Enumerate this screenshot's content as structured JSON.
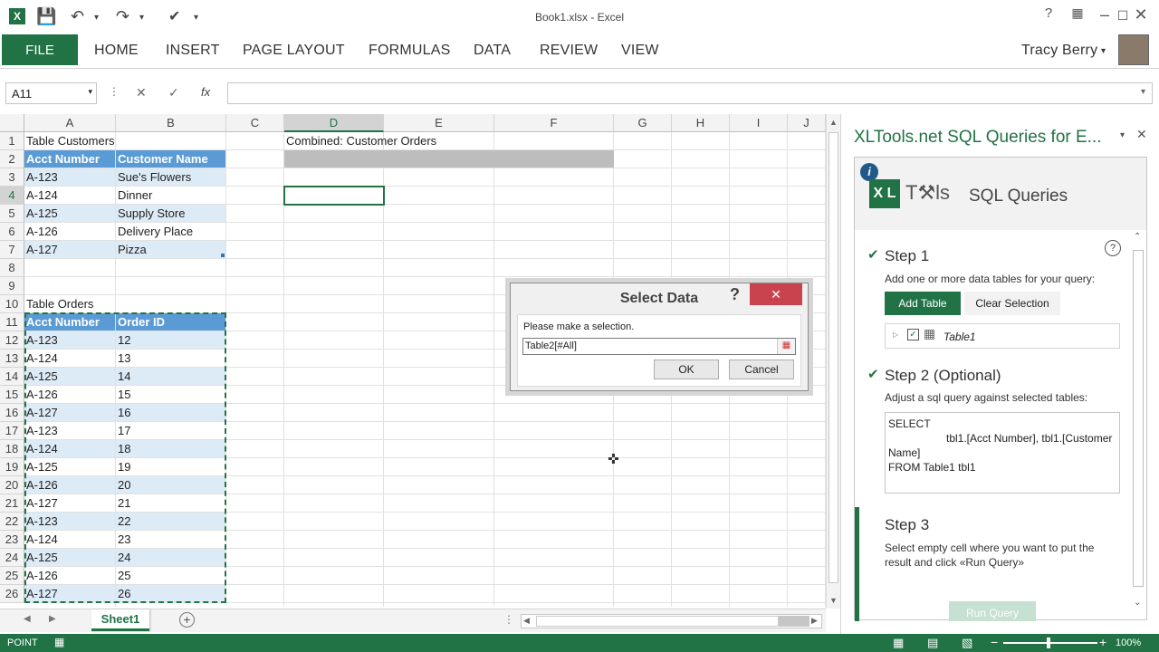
{
  "title": "Book1.xlsx - Excel",
  "user": "Tracy Berry",
  "ribbon": {
    "file": "FILE",
    "tabs": [
      "HOME",
      "INSERT",
      "PAGE LAYOUT",
      "FORMULAS",
      "DATA",
      "REVIEW",
      "VIEW"
    ]
  },
  "formula_bar": {
    "name_box": "A11",
    "fx": "fx",
    "value": ""
  },
  "columns": [
    "A",
    "B",
    "C",
    "D",
    "E",
    "F",
    "G",
    "H",
    "I",
    "J"
  ],
  "rows": [
    "1",
    "2",
    "3",
    "4",
    "5",
    "6",
    "7",
    "8",
    "9",
    "10",
    "11",
    "12",
    "13",
    "14",
    "15",
    "16",
    "17",
    "18",
    "19",
    "20",
    "21",
    "22",
    "23",
    "24",
    "25",
    "26"
  ],
  "cells": {
    "a1": "Table Customers",
    "d1": "Combined: Customer Orders",
    "a10": "Table Orders",
    "customers_headers": [
      "Acct Number",
      "Customer Name"
    ],
    "customers": [
      [
        "A-123",
        "Sue's Flowers"
      ],
      [
        "A-124",
        "Dinner"
      ],
      [
        "A-125",
        "Supply Store"
      ],
      [
        "A-126",
        "Delivery Place"
      ],
      [
        "A-127",
        "Pizza"
      ]
    ],
    "orders_headers": [
      "Acct Number",
      "Order ID"
    ],
    "orders": [
      [
        "A-123",
        "12"
      ],
      [
        "A-124",
        "13"
      ],
      [
        "A-125",
        "14"
      ],
      [
        "A-126",
        "15"
      ],
      [
        "A-127",
        "16"
      ],
      [
        "A-123",
        "17"
      ],
      [
        "A-124",
        "18"
      ],
      [
        "A-125",
        "19"
      ],
      [
        "A-126",
        "20"
      ],
      [
        "A-127",
        "21"
      ],
      [
        "A-123",
        "22"
      ],
      [
        "A-124",
        "23"
      ],
      [
        "A-125",
        "24"
      ],
      [
        "A-126",
        "25"
      ],
      [
        "A-127",
        "26"
      ]
    ]
  },
  "sheet_tab": "Sheet1",
  "status": {
    "mode": "POINT",
    "zoom": "100%"
  },
  "dialog": {
    "title": "Select Data",
    "help": "?",
    "close": "✕",
    "prompt": "Please make a selection.",
    "value": "Table2[#All]",
    "ok": "OK",
    "cancel": "Cancel"
  },
  "pane": {
    "title": "XLTools.net SQL Queries for E...",
    "logo_text": "SQL Queries",
    "step1": {
      "title": "Step 1",
      "desc": "Add one or more data tables for your query:",
      "add": "Add Table",
      "clear": "Clear Selection",
      "table": "Table1"
    },
    "step2": {
      "title": "Step 2 (Optional)",
      "desc": "Adjust a sql query against selected tables:",
      "sql_1": "SELECT",
      "sql_2": "tbl1.[Acct Number], tbl1.[Customer",
      "sql_3": "Name]",
      "sql_4": "FROM Table1 tbl1"
    },
    "step3": {
      "title": "Step 3",
      "desc_1": "Select empty cell where you want to put the",
      "desc_2": "result and click «Run Query»",
      "run": "Run Query"
    }
  },
  "colors": {
    "accent": "#217346",
    "table_header": "#5b9bd5",
    "band": "#ddebf7",
    "close_red": "#c9434f"
  }
}
